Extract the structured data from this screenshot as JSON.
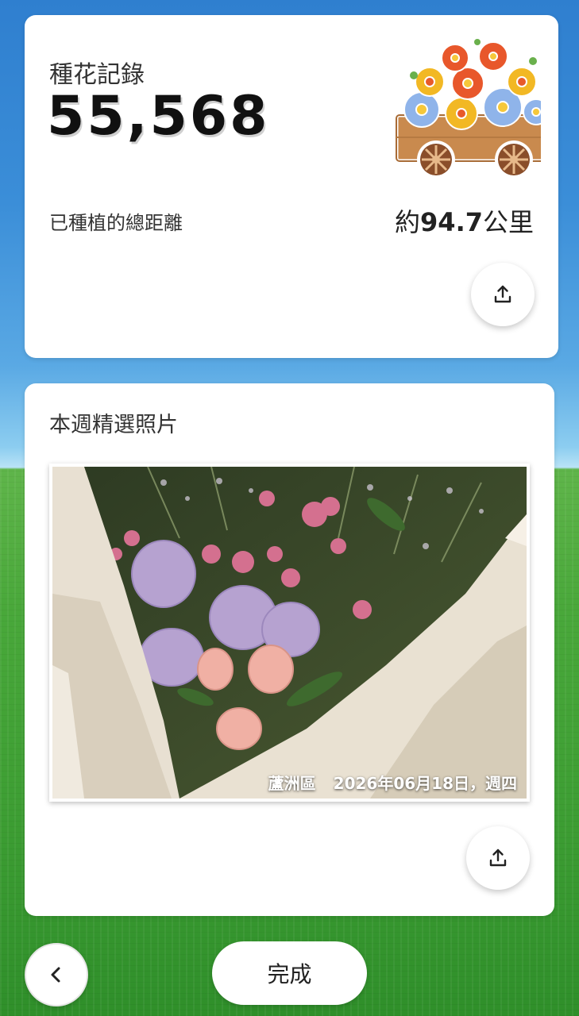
{
  "record": {
    "title": "種花記錄",
    "count": "55,568",
    "distance_label": "已種植的總距離",
    "distance_prefix": "約",
    "distance_value": "94.7",
    "distance_unit": "公里",
    "share_icon": "share-upload-icon",
    "illustration_icon": "flower-cart-icon"
  },
  "weekly_photo": {
    "title": "本週精選照片",
    "location": "蘆洲區",
    "date": "2026年06月18日，週四",
    "share_icon": "share-upload-icon"
  },
  "footer": {
    "back_icon": "chevron-left-icon",
    "done_label": "完成"
  },
  "colors": {
    "sky": "#3b8ed8",
    "grass": "#49a83a",
    "card": "#ffffff"
  }
}
